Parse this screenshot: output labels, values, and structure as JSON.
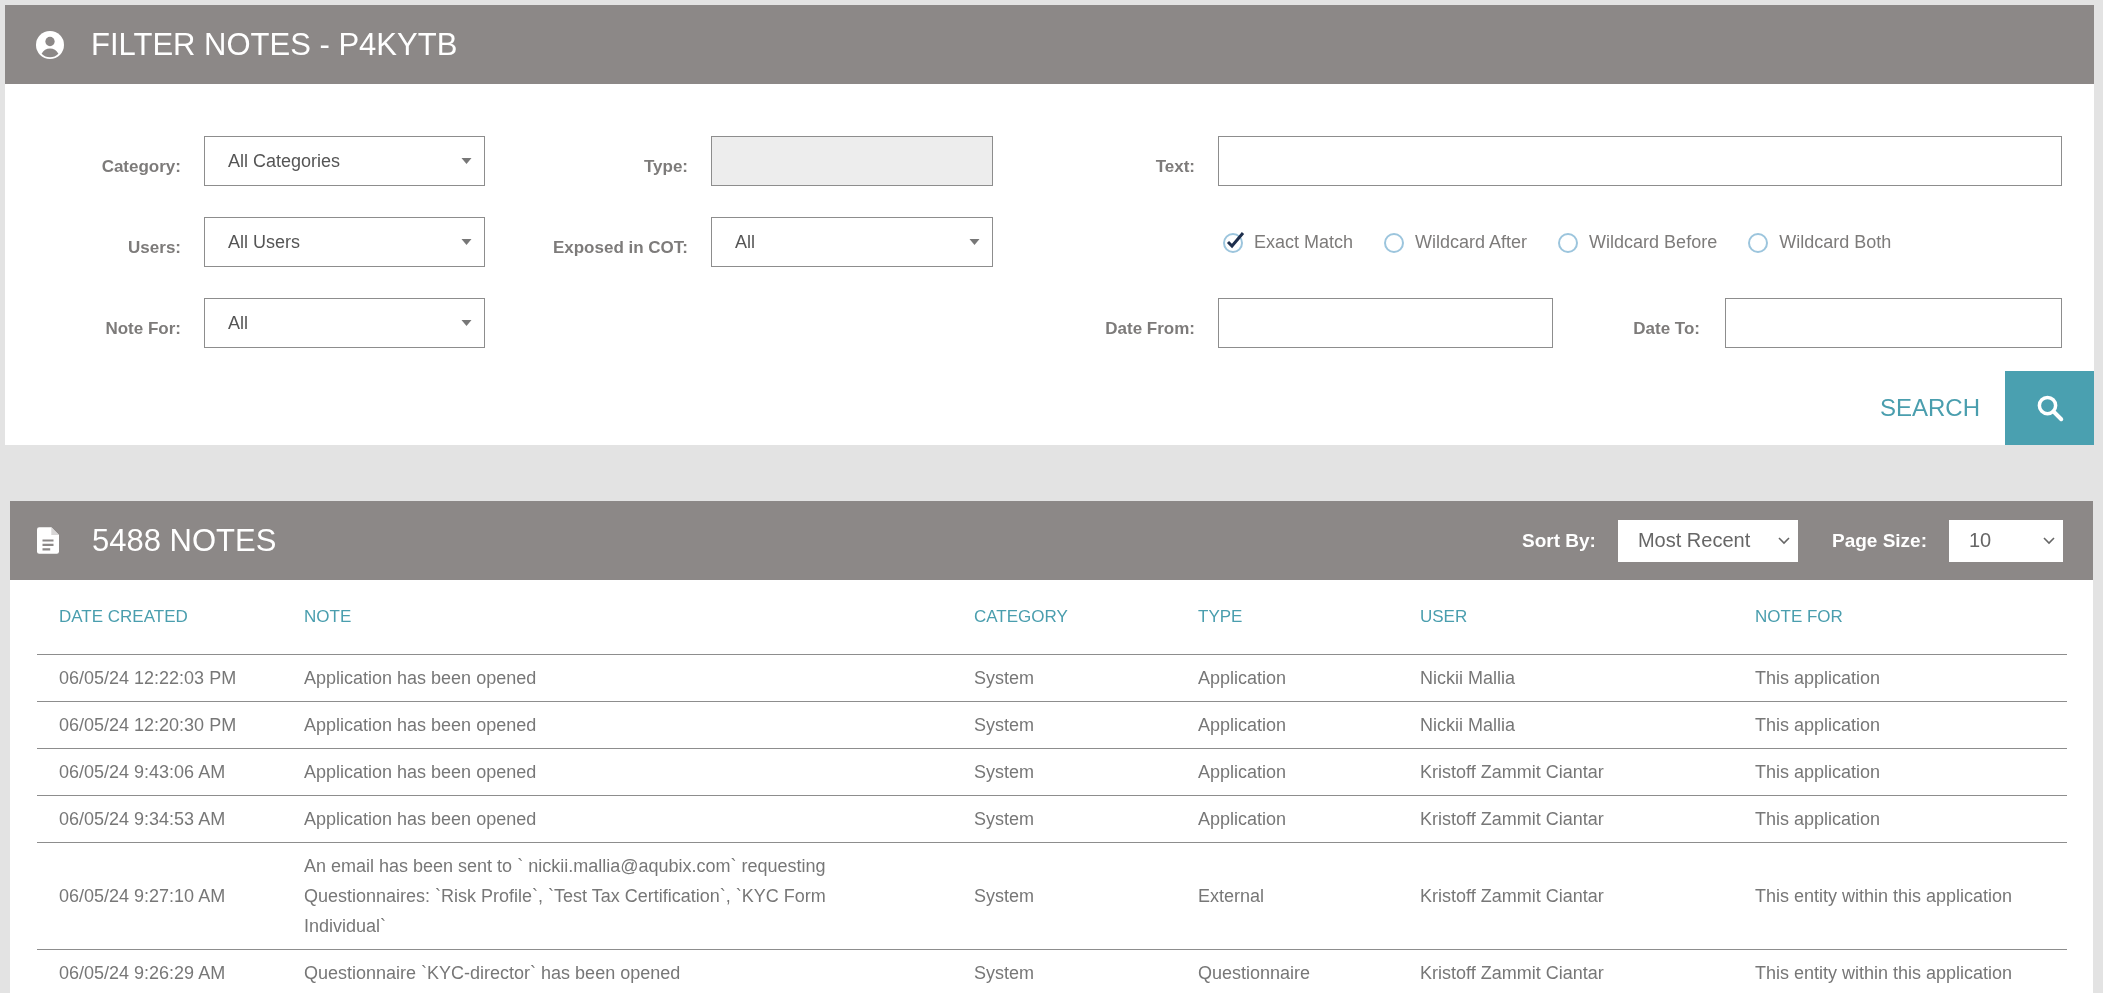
{
  "filter_panel": {
    "title": "FILTER NOTES - P4KYTB",
    "category": {
      "label": "Category:",
      "value": "All Categories"
    },
    "type": {
      "label": "Type:",
      "disabled": true
    },
    "text": {
      "label": "Text:"
    },
    "users": {
      "label": "Users:",
      "value": "All Users"
    },
    "exposed_in_cot": {
      "label": "Exposed in COT:",
      "value": "All"
    },
    "match_options": [
      {
        "label": "Exact Match",
        "selected": true
      },
      {
        "label": "Wildcard After",
        "selected": false
      },
      {
        "label": "Wildcard Before",
        "selected": false
      },
      {
        "label": "Wildcard Both",
        "selected": false
      }
    ],
    "note_for": {
      "label": "Note For:",
      "value": "All"
    },
    "date_from": {
      "label": "Date From:"
    },
    "date_to": {
      "label": "Date To:"
    },
    "search_label": "SEARCH"
  },
  "notes_panel": {
    "title": "5488 NOTES",
    "sort_by": {
      "label": "Sort By:",
      "value": "Most Recent"
    },
    "page_size": {
      "label": "Page Size:",
      "value": "10"
    },
    "table": {
      "columns": [
        "DATE CREATED",
        "NOTE",
        "CATEGORY",
        "TYPE",
        "USER",
        "NOTE FOR"
      ],
      "rows": [
        [
          "06/05/24 12:22:03 PM",
          "Application has been opened",
          "System",
          "Application",
          "Nickii Mallia",
          "This application"
        ],
        [
          "06/05/24 12:20:30 PM",
          "Application has been opened",
          "System",
          "Application",
          "Nickii Mallia",
          "This application"
        ],
        [
          "06/05/24 9:43:06 AM",
          "Application has been opened",
          "System",
          "Application",
          "Kristoff Zammit Ciantar",
          "This application"
        ],
        [
          "06/05/24 9:34:53 AM",
          "Application has been opened",
          "System",
          "Application",
          "Kristoff Zammit Ciantar",
          "This application"
        ],
        [
          "06/05/24 9:27:10 AM",
          "An email has been sent to ` nickii.mallia@aqubix.com` requesting Questionnaires: `Risk Profile`, `Test Tax Certification`, `KYC Form Individual`",
          "System",
          "External",
          "Kristoff Zammit Ciantar",
          "This entity within this application"
        ],
        [
          "06/05/24 9:26:29 AM",
          "Questionnaire `KYC-director` has been opened",
          "System",
          "Questionnaire",
          "Kristoff Zammit Ciantar",
          "This entity within this application"
        ]
      ]
    }
  }
}
